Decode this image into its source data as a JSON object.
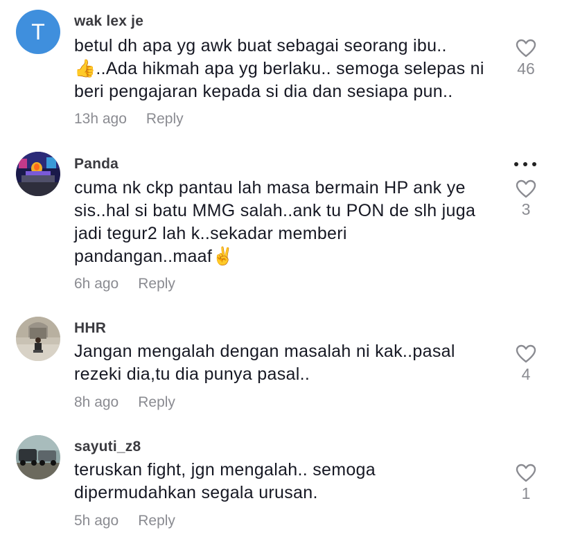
{
  "comments": [
    {
      "username": "wak lex je",
      "avatar_letter": "T",
      "text": "betul dh apa yg awk buat sebagai seorang ibu..\n👍..Ada hikmah apa yg berlaku.. semoga selepas ni\nberi pengajaran kepada si dia dan sesiapa pun..",
      "time": "13h ago",
      "reply_label": "Reply",
      "likes": "46"
    },
    {
      "username": "Panda",
      "text": "cuma nk ckp pantau lah masa bermain HP ank ye\nsis..hal si batu MMG salah..ank tu PON de slh juga\njadi tegur2 lah k..sekadar memberi\npandangan..maaf✌️",
      "time": "6h ago",
      "reply_label": "Reply",
      "likes": "3"
    },
    {
      "username": "HHR",
      "text": "Jangan mengalah dengan masalah ni kak..pasal\nrezeki dia,tu dia punya pasal..",
      "time": "8h ago",
      "reply_label": "Reply",
      "likes": "4"
    },
    {
      "username": "sayuti_z8",
      "text": "teruskan fight, jgn mengalah.. semoga\ndipermudahkan segala urusan.",
      "time": "5h ago",
      "reply_label": "Reply",
      "likes": "1"
    }
  ],
  "icons": {
    "like": "heart-outline-icon",
    "more": "more-dots-icon"
  },
  "colors": {
    "avatar_letter_bg": "#3f8fdd",
    "text": "#161823",
    "muted": "#8a8b91"
  }
}
